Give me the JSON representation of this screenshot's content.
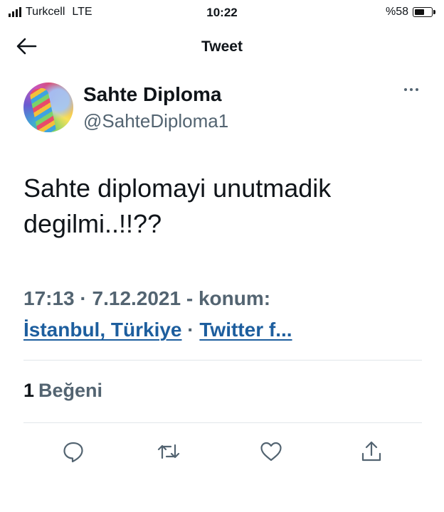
{
  "status_bar": {
    "carrier": "Turkcell",
    "network": "LTE",
    "time": "10:22",
    "battery": "%58",
    "battery_level": 0.58
  },
  "nav": {
    "title": "Tweet",
    "back_icon": "arrow-left-icon"
  },
  "tweet": {
    "author_name": "Sahte Diploma",
    "author_handle": "@SahteDiploma1",
    "text_line1": "Sahte diplomayi unutmadik",
    "text_line2": "degilmi..!!??",
    "time": "17:13",
    "sep1": " · ",
    "date": "7.12.2021",
    "sep2": " - ",
    "location_prefix": "konum:",
    "location": "İstanbul, Türkiye",
    "sep3": " · ",
    "source": "Twitter f..."
  },
  "engagement": {
    "likes_count": "1",
    "likes_label": "Beğeni"
  },
  "actions": [
    "reply-icon",
    "retweet-icon",
    "like-icon",
    "share-icon"
  ],
  "colors": {
    "text": "#0f1419",
    "secondary": "#536471",
    "link": "#1d5e9e",
    "divider": "#e1e6ea"
  }
}
